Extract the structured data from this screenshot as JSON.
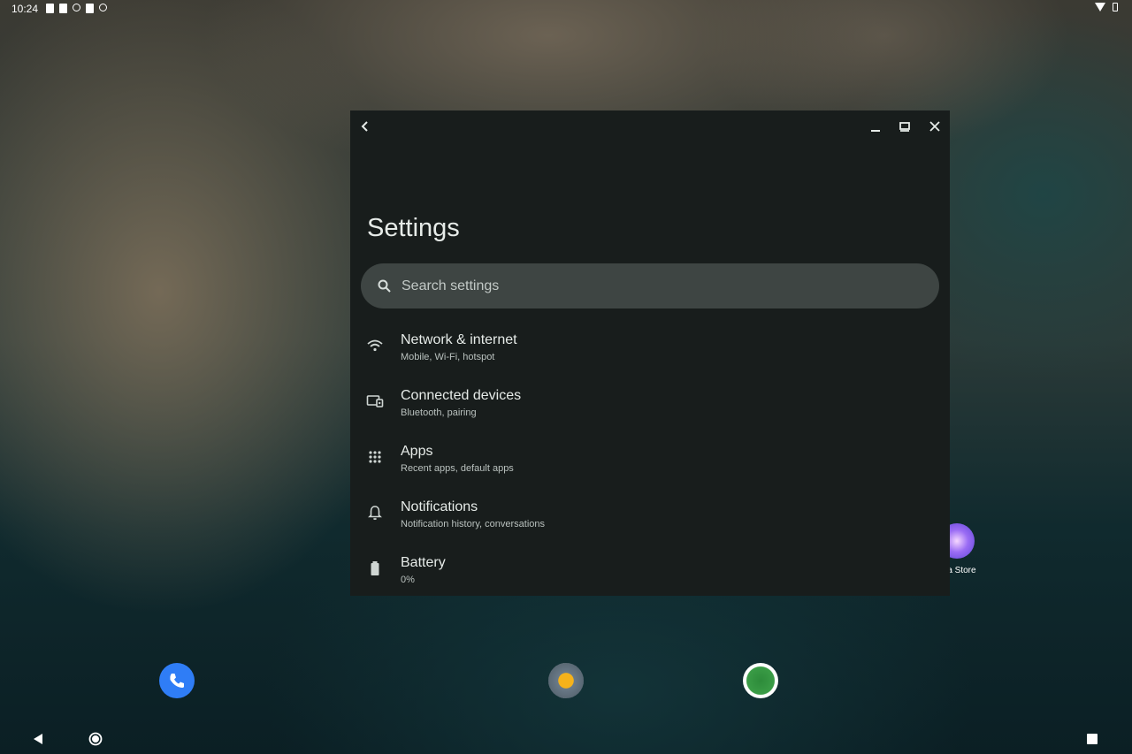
{
  "status_bar": {
    "time": "10:24"
  },
  "window": {
    "title": "Settings",
    "controls": [
      "back",
      "minimize",
      "maximize",
      "close"
    ],
    "search": {
      "placeholder": "Search settings"
    },
    "items": [
      {
        "title": "Network & internet",
        "subtitle": "Mobile, Wi‑Fi, hotspot",
        "icon": "wifi-icon"
      },
      {
        "title": "Connected devices",
        "subtitle": "Bluetooth, pairing",
        "icon": "devices-icon"
      },
      {
        "title": "Apps",
        "subtitle": "Recent apps, default apps",
        "icon": "apps-grid-icon"
      },
      {
        "title": "Notifications",
        "subtitle": "Notification history, conversations",
        "icon": "bell-icon"
      },
      {
        "title": "Battery",
        "subtitle": "0%",
        "icon": "battery-icon"
      }
    ]
  },
  "desktop": {
    "app_label": "ra Store"
  },
  "colors": {
    "window_bg": "#181d1c",
    "search_bg": "#3e4543",
    "accent_blue": "#2f7df6"
  }
}
